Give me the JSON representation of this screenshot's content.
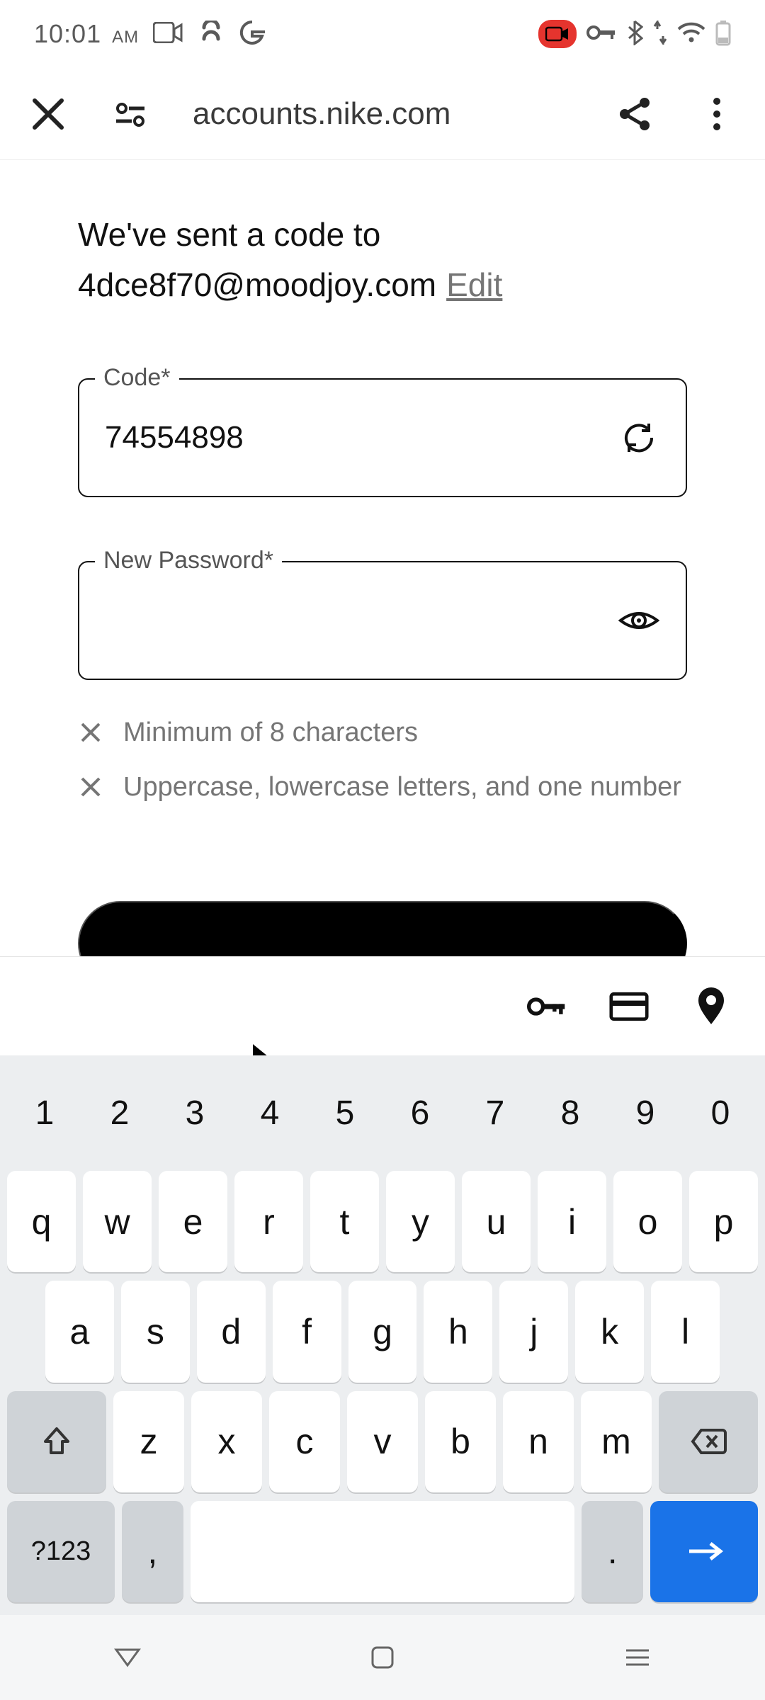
{
  "status": {
    "time": "10:01",
    "ampm": "AM"
  },
  "browser": {
    "url": "accounts.nike.com"
  },
  "page": {
    "intro": "We've sent a code to",
    "email": "4dce8f70@moodjoy.com",
    "edit": "Edit",
    "code_label": "Code*",
    "code_value": "74554898",
    "password_label": "New Password*",
    "password_value": "",
    "req1": "Minimum of 8 characters",
    "req2": "Uppercase, lowercase letters, and one number"
  },
  "keyboard": {
    "numbers": [
      "1",
      "2",
      "3",
      "4",
      "5",
      "6",
      "7",
      "8",
      "9",
      "0"
    ],
    "row1": [
      "q",
      "w",
      "e",
      "r",
      "t",
      "y",
      "u",
      "i",
      "o",
      "p"
    ],
    "row2": [
      "a",
      "s",
      "d",
      "f",
      "g",
      "h",
      "j",
      "k",
      "l"
    ],
    "row3": [
      "z",
      "x",
      "c",
      "v",
      "b",
      "n",
      "m"
    ],
    "symkey": "?123",
    "comma": ",",
    "period": "."
  }
}
